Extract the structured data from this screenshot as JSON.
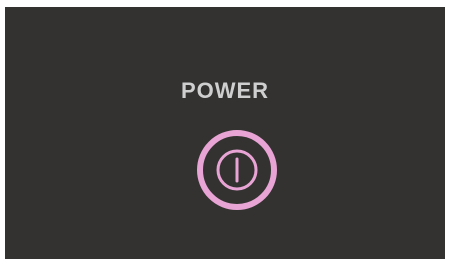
{
  "screen": {
    "title": "POWER"
  },
  "power_button": {
    "icon": "power-icon",
    "ring_color": "#E8A4D4",
    "icon_color": "#E8A4D4"
  },
  "colors": {
    "background": "#333231",
    "title_text": "#CFCFCF"
  }
}
